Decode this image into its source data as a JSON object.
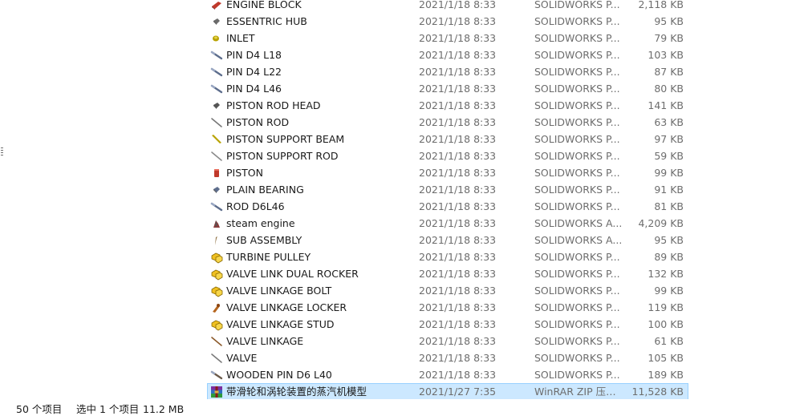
{
  "files": [
    {
      "name": "ENGINE BLOCK",
      "date": "2021/1/18 8:33",
      "type": "SOLIDWORKS P...",
      "size": "2,118 KB",
      "icon": "part-block-icon",
      "color": "#c0392b"
    },
    {
      "name": "ESSENTRIC HUB",
      "date": "2021/1/18 8:33",
      "type": "SOLIDWORKS P...",
      "size": "95 KB",
      "icon": "part-hub-icon",
      "color": "#6b6b6b"
    },
    {
      "name": "INLET",
      "date": "2021/1/18 8:33",
      "type": "SOLIDWORKS P...",
      "size": "79 KB",
      "icon": "part-inlet-icon",
      "color": "#b8a200"
    },
    {
      "name": "PIN D4 L18",
      "date": "2021/1/18 8:33",
      "type": "SOLIDWORKS P...",
      "size": "103 KB",
      "icon": "part-pin-icon",
      "color": "#5d6d8c"
    },
    {
      "name": "PIN D4 L22",
      "date": "2021/1/18 8:33",
      "type": "SOLIDWORKS P...",
      "size": "87 KB",
      "icon": "part-pin-icon",
      "color": "#5d6d8c"
    },
    {
      "name": "PIN D4 L46",
      "date": "2021/1/18 8:33",
      "type": "SOLIDWORKS P...",
      "size": "80 KB",
      "icon": "part-pin-icon",
      "color": "#5d6d8c"
    },
    {
      "name": "PISTON ROD HEAD",
      "date": "2021/1/18 8:33",
      "type": "SOLIDWORKS P...",
      "size": "141 KB",
      "icon": "part-rod-head-icon",
      "color": "#555555"
    },
    {
      "name": "PISTON ROD",
      "date": "2021/1/18 8:33",
      "type": "SOLIDWORKS P...",
      "size": "63 KB",
      "icon": "part-rod-icon",
      "color": "#777777"
    },
    {
      "name": "PISTON SUPPORT BEAM",
      "date": "2021/1/18 8:33",
      "type": "SOLIDWORKS P...",
      "size": "97 KB",
      "icon": "part-beam-icon",
      "color": "#b8a200"
    },
    {
      "name": "PISTON SUPPORT ROD",
      "date": "2021/1/18 8:33",
      "type": "SOLIDWORKS P...",
      "size": "59 KB",
      "icon": "part-rod-icon",
      "color": "#8a8a8a"
    },
    {
      "name": "PISTON",
      "date": "2021/1/18 8:33",
      "type": "SOLIDWORKS P...",
      "size": "99 KB",
      "icon": "part-piston-icon",
      "color": "#c0392b"
    },
    {
      "name": "PLAIN BEARING",
      "date": "2021/1/18 8:33",
      "type": "SOLIDWORKS P...",
      "size": "91 KB",
      "icon": "part-bearing-icon",
      "color": "#5d6d8c"
    },
    {
      "name": "ROD D6L46",
      "date": "2021/1/18 8:33",
      "type": "SOLIDWORKS P...",
      "size": "81 KB",
      "icon": "part-pin-icon",
      "color": "#5d6d8c"
    },
    {
      "name": "steam engine",
      "date": "2021/1/18 8:33",
      "type": "SOLIDWORKS A...",
      "size": "4,209 KB",
      "icon": "assembly-engine-icon",
      "color": "#8b3a3a"
    },
    {
      "name": "SUB ASSEMBLY",
      "date": "2021/1/18 8:33",
      "type": "SOLIDWORKS A...",
      "size": "95 KB",
      "icon": "assembly-sub-icon",
      "color": "#8b6b3a"
    },
    {
      "name": "TURBINE PULLEY",
      "date": "2021/1/18 8:33",
      "type": "SOLIDWORKS P...",
      "size": "89 KB",
      "icon": "solidworks-part-icon",
      "color": "#f0c020"
    },
    {
      "name": "VALVE LINK DUAL ROCKER",
      "date": "2021/1/18 8:33",
      "type": "SOLIDWORKS P...",
      "size": "132 KB",
      "icon": "solidworks-part-icon",
      "color": "#f0c020"
    },
    {
      "name": "VALVE LINKAGE BOLT",
      "date": "2021/1/18 8:33",
      "type": "SOLIDWORKS P...",
      "size": "99 KB",
      "icon": "solidworks-part-icon",
      "color": "#f0c020"
    },
    {
      "name": "VALVE LINKAGE LOCKER",
      "date": "2021/1/18 8:33",
      "type": "SOLIDWORKS P...",
      "size": "119 KB",
      "icon": "part-locker-icon",
      "color": "#b5651d"
    },
    {
      "name": "VALVE LINKAGE STUD",
      "date": "2021/1/18 8:33",
      "type": "SOLIDWORKS P...",
      "size": "100 KB",
      "icon": "solidworks-part-icon",
      "color": "#f0c020"
    },
    {
      "name": "VALVE LINKAGE",
      "date": "2021/1/18 8:33",
      "type": "SOLIDWORKS P...",
      "size": "61 KB",
      "icon": "part-rod-icon",
      "color": "#8b5a2b"
    },
    {
      "name": "VALVE",
      "date": "2021/1/18 8:33",
      "type": "SOLIDWORKS P...",
      "size": "105 KB",
      "icon": "part-rod-icon",
      "color": "#7a7a7a"
    },
    {
      "name": "WOODEN PIN D6 L40",
      "date": "2021/1/18 8:33",
      "type": "SOLIDWORKS P...",
      "size": "189 KB",
      "icon": "part-pin-icon",
      "color": "#6b5a4a"
    },
    {
      "name": "带滑轮和涡轮装置的蒸汽机模型",
      "date": "2021/1/27 7:35",
      "type": "WinRAR ZIP 压缩...",
      "size": "11,528 KB",
      "icon": "winrar-archive-icon",
      "color": "#8b1a1a",
      "selected": true
    }
  ],
  "status": {
    "item_count": "50 个项目",
    "selected_count": "选中 1 个项目",
    "selected_size": "11.2 MB"
  }
}
